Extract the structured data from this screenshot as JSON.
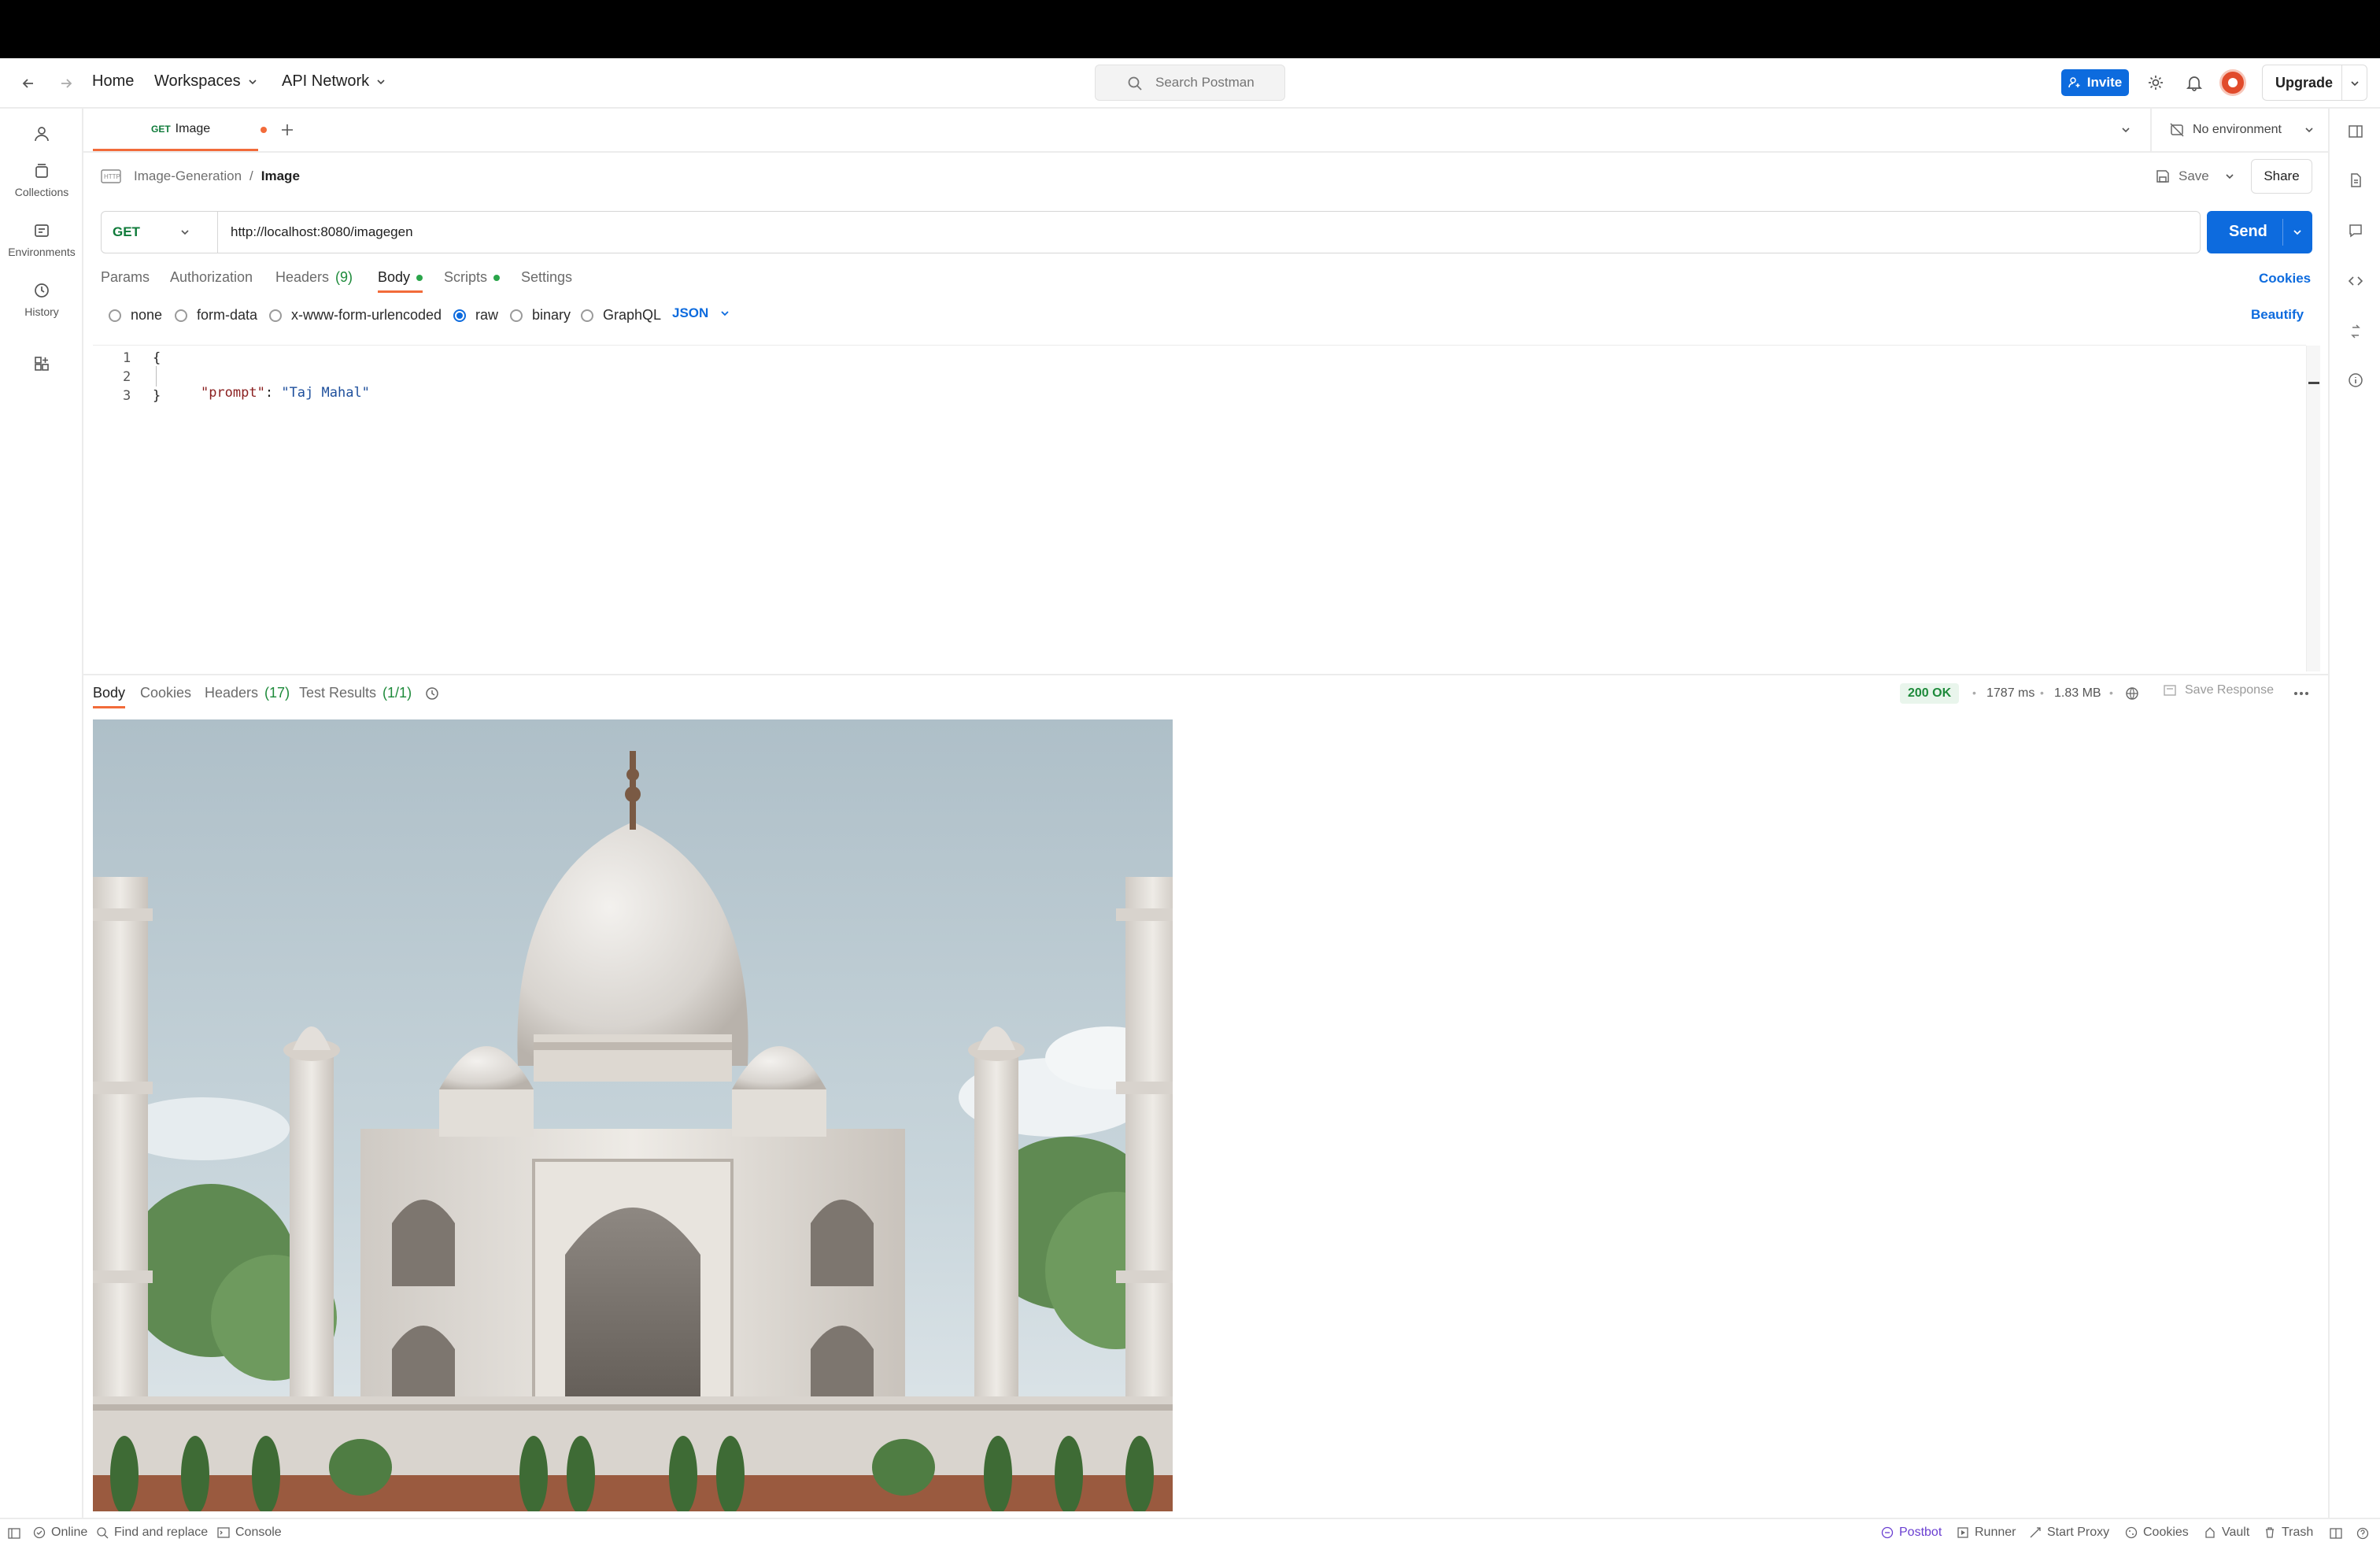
{
  "nav": {
    "home": "Home",
    "workspaces": "Workspaces",
    "api_network": "API Network",
    "search_placeholder": "Search Postman",
    "invite": "Invite",
    "upgrade": "Upgrade"
  },
  "sidebar": {
    "items": [
      {
        "label": "",
        "icon": "user-icon"
      },
      {
        "label": "Collections",
        "icon": "collections-icon"
      },
      {
        "label": "Environments",
        "icon": "environments-icon"
      },
      {
        "label": "History",
        "icon": "history-icon"
      },
      {
        "label": "",
        "icon": "add-workspace-icon"
      }
    ]
  },
  "tabs": {
    "active_method": "GET",
    "active_name": "Image",
    "environment": "No environment"
  },
  "breadcrumb": {
    "collection": "Image-Generation",
    "separator": "/",
    "request": "Image",
    "save": "Save",
    "share": "Share"
  },
  "request": {
    "method": "GET",
    "url": "http://localhost:8080/imagegen",
    "send": "Send"
  },
  "request_tabs": {
    "params": "Params",
    "authorization": "Authorization",
    "headers": "Headers",
    "headers_count": "(9)",
    "body": "Body",
    "scripts": "Scripts",
    "settings": "Settings",
    "cookies": "Cookies"
  },
  "body_options": {
    "none": "none",
    "form_data": "form-data",
    "urlencoded": "x-www-form-urlencoded",
    "raw": "raw",
    "binary": "binary",
    "graphql": "GraphQL",
    "format": "JSON",
    "beautify": "Beautify"
  },
  "editor": {
    "lines": [
      {
        "num": "1",
        "text": "{"
      },
      {
        "num": "2",
        "key": "\"prompt\"",
        "colon": ": ",
        "value": "\"Taj Mahal\""
      },
      {
        "num": "3",
        "text": "}"
      }
    ]
  },
  "response": {
    "tabs": {
      "body": "Body",
      "cookies": "Cookies",
      "headers": "Headers",
      "headers_count": "(17)",
      "tests": "Test Results",
      "tests_count": "(1/1)"
    },
    "status": "200 OK",
    "time": "1787 ms",
    "size": "1.83 MB",
    "save_response": "Save Response",
    "image_subject": "Taj Mahal"
  },
  "footer": {
    "online": "Online",
    "find_replace": "Find and replace",
    "console": "Console",
    "postbot": "Postbot",
    "runner": "Runner",
    "start_proxy": "Start Proxy",
    "cookies": "Cookies",
    "vault": "Vault",
    "trash": "Trash"
  },
  "colors": {
    "accent_blue": "#0d6bde",
    "tab_orange": "#f26b3a",
    "success_green": "#1d8a3a",
    "method_green": "#0f7b3a"
  }
}
